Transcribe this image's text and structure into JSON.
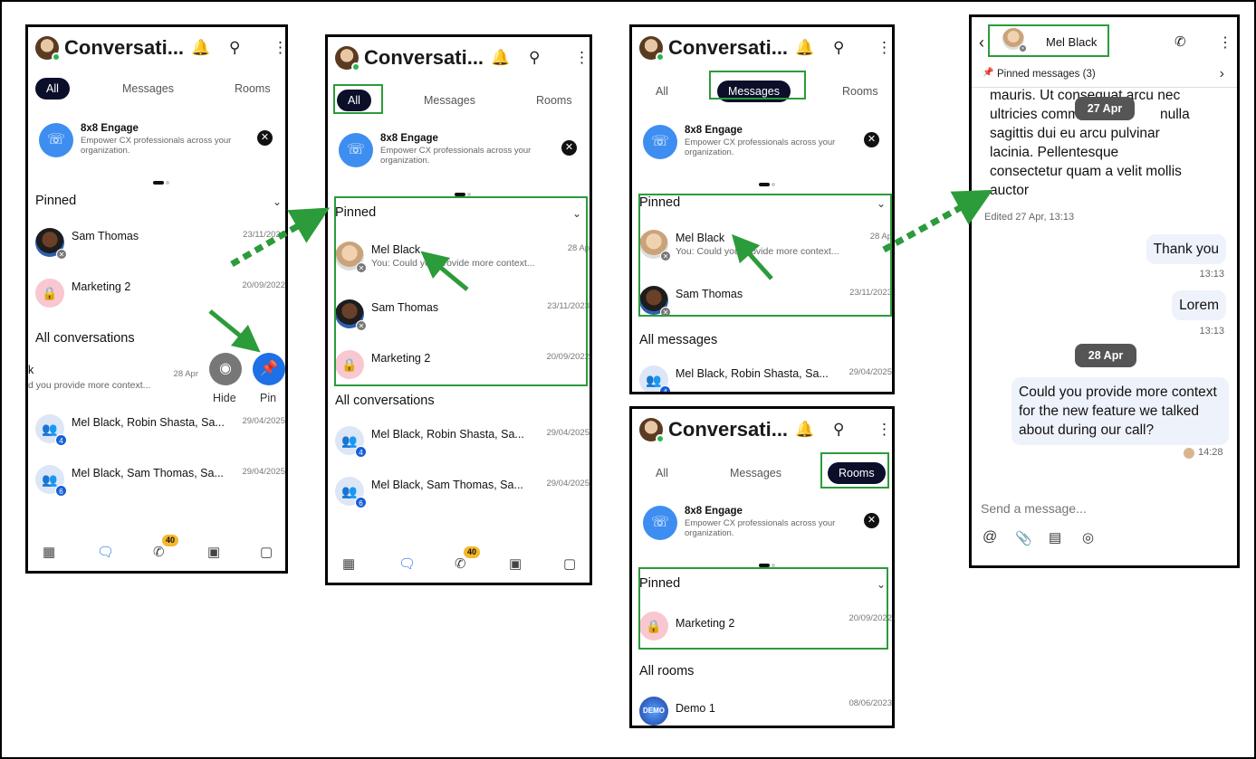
{
  "colors": {
    "accent_green": "#2c9b3a",
    "tab_active": "#0b0f2a",
    "pin_blue": "#1f6fe6",
    "badge_yellow": "#f5b82a"
  },
  "app": {
    "title": "Conversati...",
    "tabs": {
      "all": "All",
      "messages": "Messages",
      "rooms": "Rooms"
    },
    "promo": {
      "title": "8x8 Engage",
      "desc": "Empower CX professionals across your organization."
    },
    "pinned": "Pinned",
    "all_conversations": "All conversations",
    "all_messages": "All messages",
    "all_rooms": "All rooms",
    "swipe": {
      "name": "k",
      "sub": "d you provide more context...",
      "date": "28 Apr",
      "hide": "Hide",
      "pin": "Pin"
    },
    "calls_badge": "40"
  },
  "rows": {
    "sam": {
      "name": "Sam Thomas",
      "date": "23/11/2023"
    },
    "sam_s1": {
      "date": "23/11/20..."
    },
    "marketing": {
      "name": "Marketing 2",
      "date": "20/09/2022"
    },
    "mel": {
      "name": "Mel Black",
      "sub": "You: Could you provide more context...",
      "date": "28 Ap"
    },
    "group1": {
      "name": "Mel Black, Robin Shasta, Sa...",
      "date": "29/04/2025"
    },
    "group2": {
      "name": "Mel Black, Sam Thomas, Sa...",
      "date": "29/04/2025"
    },
    "demo": {
      "name": "Demo 1",
      "date": "08/06/2023",
      "avatar": "DEMO"
    },
    "group1_num": "4",
    "group2_num": "6"
  },
  "chat": {
    "contact": "Mel Black",
    "pinned_bar": "Pinned messages (3)",
    "body": "mauris. Ut consequat arcu nec ultricies comm...odo nulla sagittis dui eu arcu pulvinar lacinia. Pellentesque consectetur quam a velit mollis auctor",
    "body_lines": [
      "mauris. Ut consequat arcu nec",
      "ultricies comm",
      "nulla",
      "sagittis dui eu arcu pulvinar",
      "lacinia. Pellentesque",
      "consectetur quam a velit mollis",
      "auctor"
    ],
    "date1": "27 Apr",
    "edited": "Edited 27 Apr, 13:13",
    "msg1": "Thank you",
    "time1": "13:13",
    "msg2": "Lorem",
    "time2": "13:13",
    "date2": "28 Apr",
    "msg3": "Could you provide more context for the new feature we talked about during our call?",
    "time3": "14:28",
    "placeholder": "Send a message..."
  }
}
